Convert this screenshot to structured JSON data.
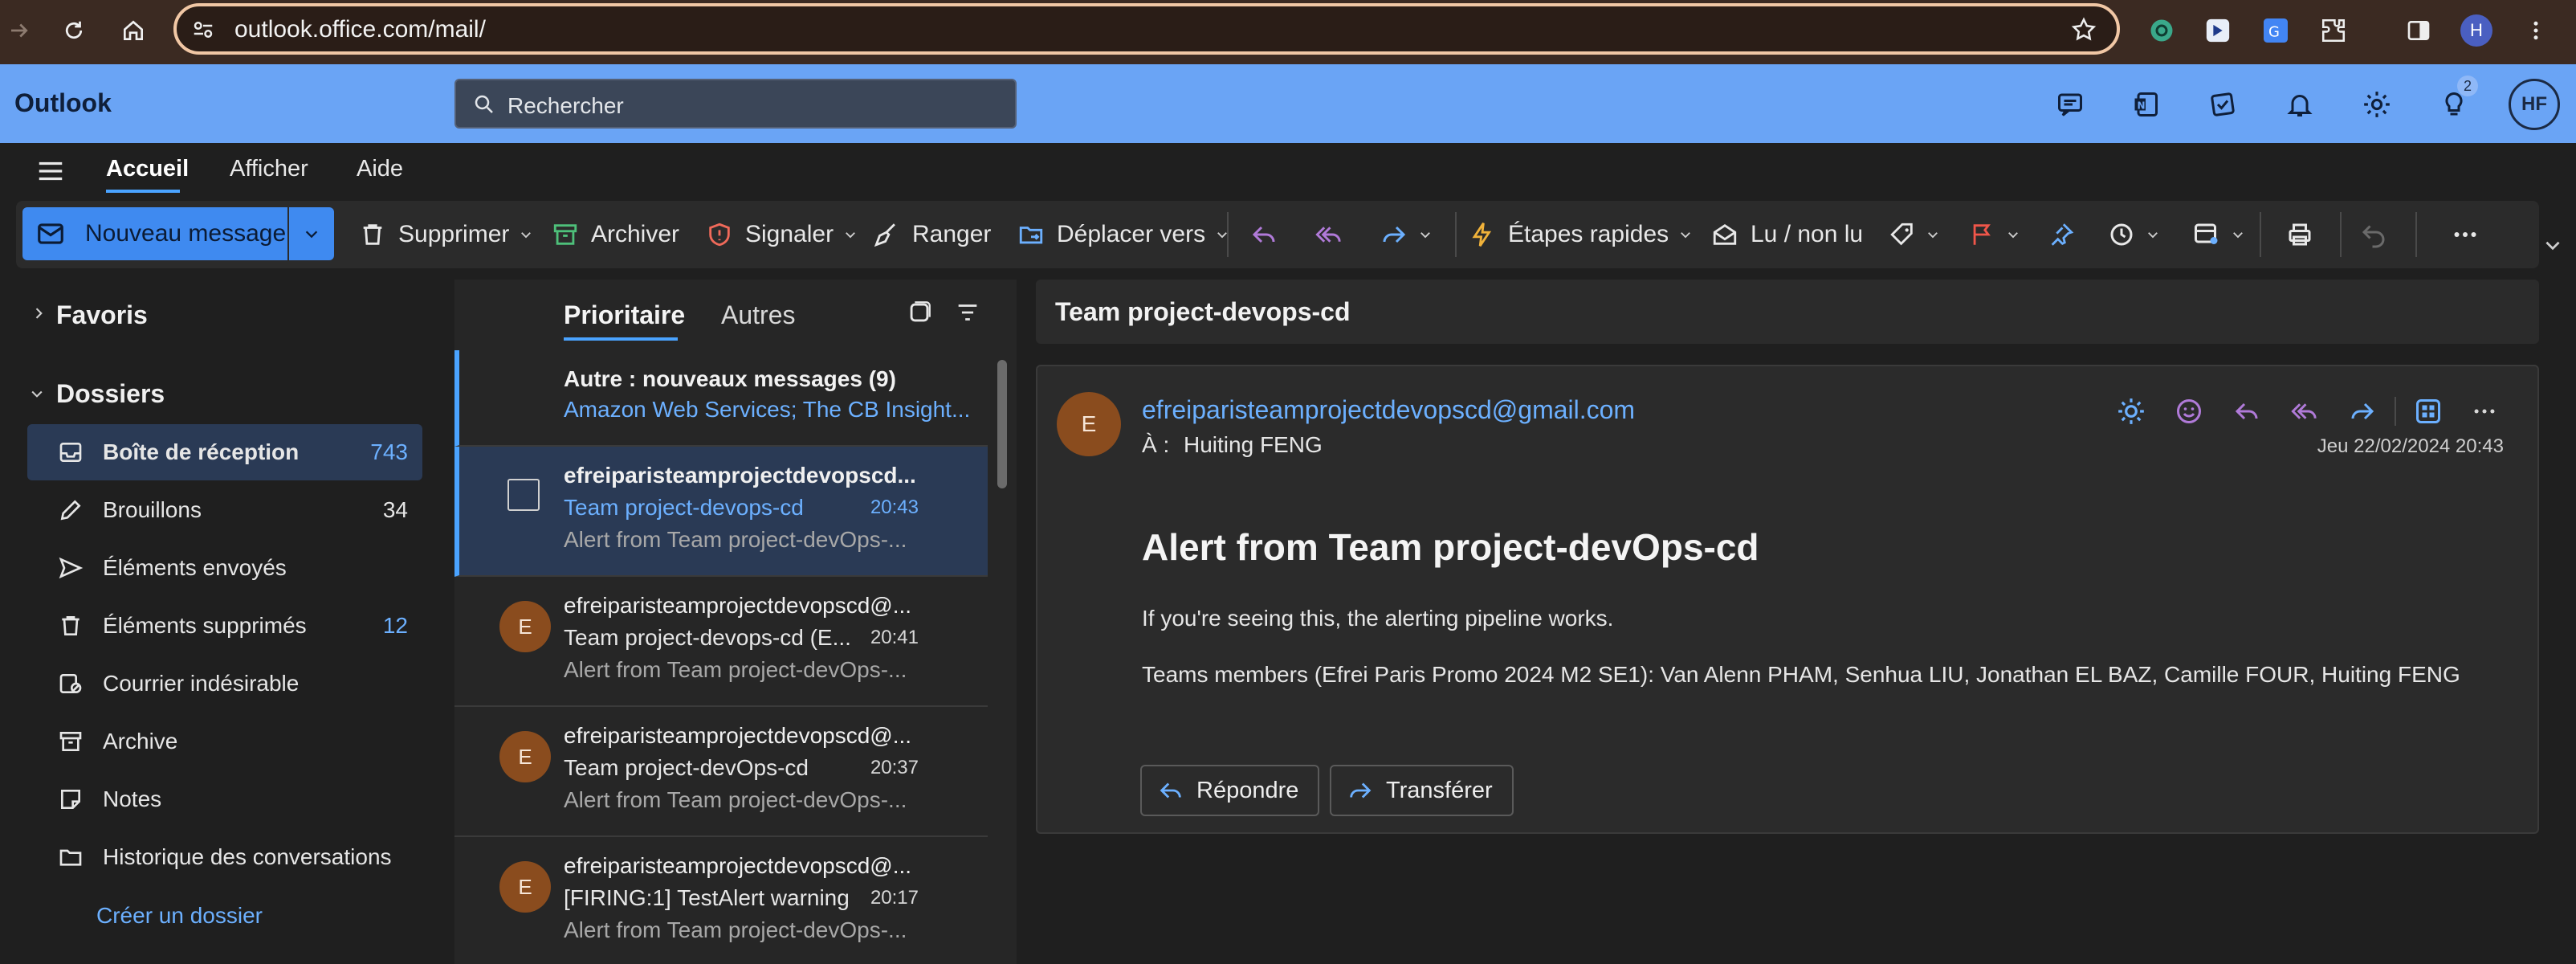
{
  "browser": {
    "url": "outlook.office.com/mail/",
    "profile_initial": "H"
  },
  "app": {
    "title": "Outlook",
    "search_placeholder": "Rechercher",
    "user_initials": "HF",
    "tips_badge": "2",
    "accent_color": "#6aa4f5"
  },
  "ribbon": {
    "tabs": [
      {
        "label": "Accueil",
        "selected": true
      },
      {
        "label": "Afficher"
      },
      {
        "label": "Aide"
      }
    ]
  },
  "toolbar": {
    "new_message": "Nouveau message",
    "delete": "Supprimer",
    "archive": "Archiver",
    "report": "Signaler",
    "sweep": "Ranger",
    "move_to": "Déplacer vers",
    "quick_steps": "Étapes rapides",
    "read_unread": "Lu / non lu"
  },
  "nav": {
    "favorites": "Favoris",
    "folders": "Dossiers",
    "items": [
      {
        "label": "Boîte de réception",
        "count": "743",
        "icon": "inbox-icon",
        "selected": true
      },
      {
        "label": "Brouillons",
        "count": "34",
        "icon": "drafts-icon"
      },
      {
        "label": "Éléments envoyés",
        "count": "",
        "icon": "sent-icon"
      },
      {
        "label": "Éléments supprimés",
        "count": "12",
        "icon": "trash-icon"
      },
      {
        "label": "Courrier indésirable",
        "count": "",
        "icon": "junk-icon"
      },
      {
        "label": "Archive",
        "count": "",
        "icon": "archive-icon"
      },
      {
        "label": "Notes",
        "count": "",
        "icon": "notes-icon"
      },
      {
        "label": "Historique des conversations",
        "count": "",
        "icon": "folder-icon"
      }
    ],
    "create_folder": "Créer un dossier"
  },
  "list": {
    "tab_focused": "Prioritaire",
    "tab_other": "Autres",
    "other_banner": {
      "title": "Autre : nouveaux messages (9)",
      "senders": "Amazon Web Services; The CB Insight..."
    },
    "messages": [
      {
        "from": "efreiparisteamprojectdevopscd...",
        "subject": "Team project-devops-cd",
        "time": "20:43",
        "preview": "Alert from Team project-devOps-...",
        "avatar": "",
        "selected": true
      },
      {
        "from": "efreiparisteamprojectdevopscd@...",
        "subject": "Team project-devops-cd (E...",
        "time": "20:41",
        "preview": "Alert from Team project-devOps-...",
        "avatar": "E"
      },
      {
        "from": "efreiparisteamprojectdevopscd@...",
        "subject": "Team project-devOps-cd",
        "time": "20:37",
        "preview": "Alert from Team project-devOps-...",
        "avatar": "E"
      },
      {
        "from": "efreiparisteamprojectdevopscd@...",
        "subject": "[FIRING:1] TestAlert warning",
        "time": "20:17",
        "preview": "Alert from Team project-devOps-...",
        "avatar": "E"
      }
    ]
  },
  "reading": {
    "conversation_title": "Team project-devops-cd",
    "sender_initial": "E",
    "sender_email": "efreiparisteamprojectdevopscd@gmail.com",
    "to_label": "À :",
    "to_name": "Huiting FENG",
    "date": "Jeu 22/02/2024 20:43",
    "heading": "Alert from Team project-devOps-cd",
    "paragraph1": "If you're seeing this, the alerting pipeline works.",
    "paragraph2": "Teams members (Efrei Paris Promo 2024 M2 SE1): Van Alenn PHAM, Senhua LIU, Jonathan EL BAZ, Camille FOUR, Huiting FENG",
    "reply": "Répondre",
    "forward": "Transférer"
  }
}
